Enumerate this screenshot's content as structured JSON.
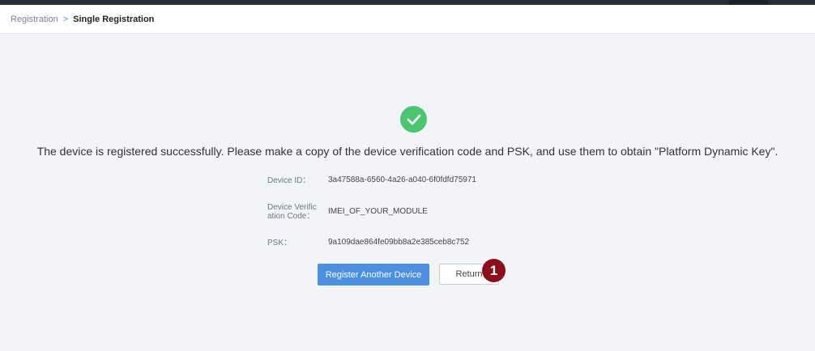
{
  "breadcrumb": {
    "parent": "Registration",
    "separator": ">",
    "current": "Single Registration"
  },
  "success": {
    "icon": "check-circle-icon",
    "color": "#4cc56f",
    "message": "The device is registered successfully. Please make a copy of the device verification code and PSK, and use them to obtain \"Platform Dynamic Key\"."
  },
  "fields": {
    "device_id": {
      "label": "Device ID：",
      "value": "3a47588a-6560-4a26-a040-6f0fdfd75971"
    },
    "verification_code": {
      "label_line1": "Device Verific",
      "label_line2": "ation Code：",
      "value": "IMEI_OF_YOUR_MODULE"
    },
    "psk": {
      "label": "PSK：",
      "value": "9a109dae864fe09bb8a2e385ceb8c752"
    }
  },
  "actions": {
    "register_another": "Register Another Device",
    "return": "Return"
  },
  "badge": {
    "text": "1",
    "color": "#8b0f1a"
  },
  "colors": {
    "primary": "#4a8fe0",
    "background": "#f3f4f8"
  }
}
